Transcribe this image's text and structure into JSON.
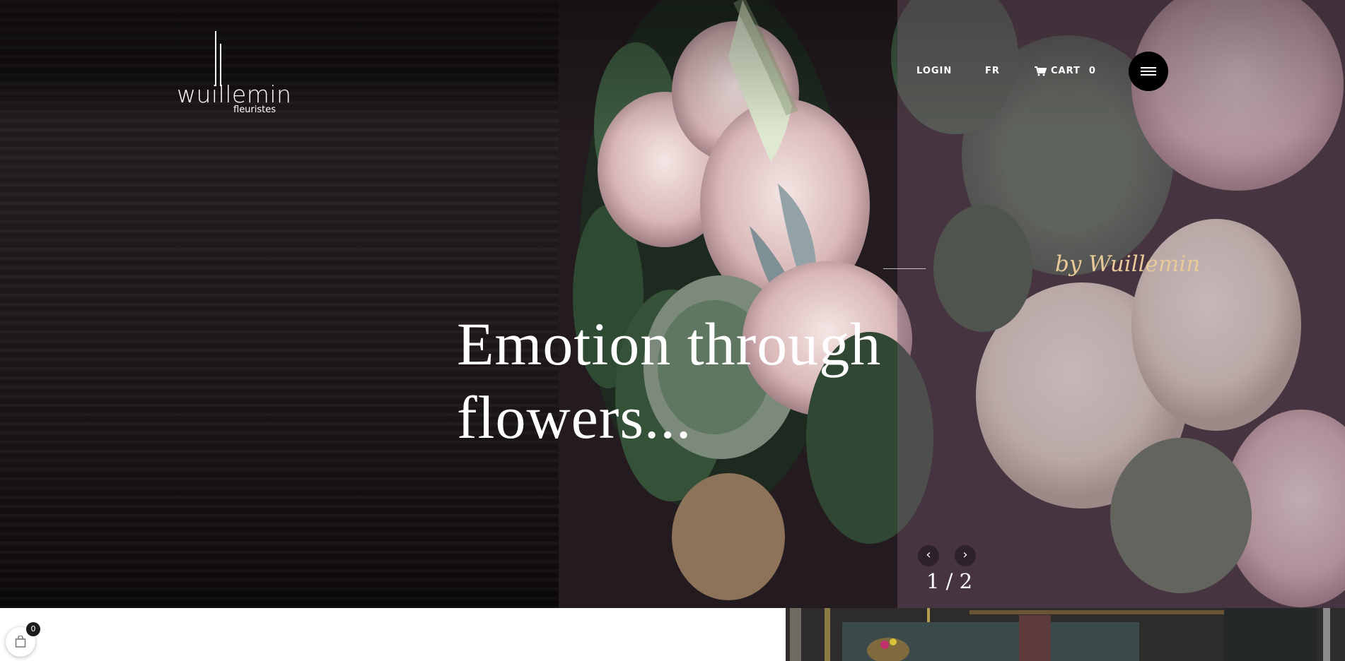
{
  "brand": {
    "name": "wuillemin",
    "subtitle": "fleuristes"
  },
  "nav": {
    "login": "LOGIN",
    "language": "FR",
    "cart_label": "CART",
    "cart_count": "0",
    "menu_icon": "hamburger-icon"
  },
  "hero": {
    "tagline": "by Wuillemin",
    "headline": "Emotion through flowers...",
    "slide_counter": "1 / 2",
    "prev_icon": "chevron-left-icon",
    "next_icon": "chevron-right-icon"
  },
  "floating_cart": {
    "count": "0",
    "icon": "shopping-bag-icon"
  },
  "colors": {
    "accent": "#e8c999",
    "overlay": "#785a6e",
    "button": "#000000"
  }
}
